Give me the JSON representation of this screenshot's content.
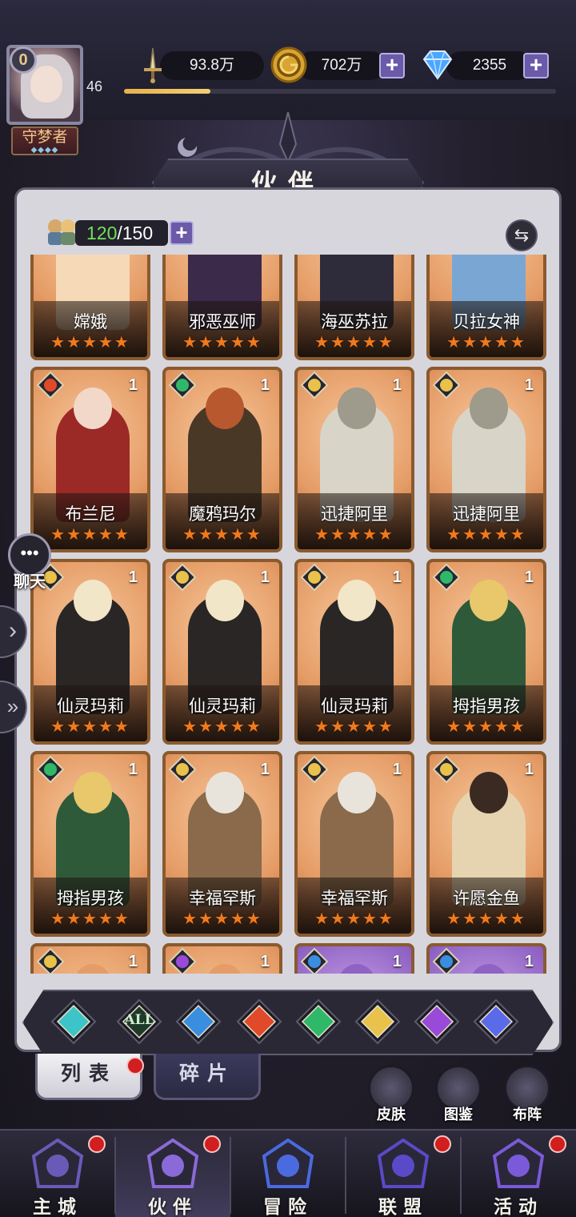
{
  "player": {
    "vip_level": "0",
    "title": "守梦者",
    "title_stars": "◆◆◆◆",
    "level": "46",
    "exp_progress": 0.2
  },
  "resources": {
    "power": "93.8万",
    "gold": "702万",
    "diamonds": "2355"
  },
  "panel": {
    "title": "伙伴",
    "capacity_current": "120",
    "capacity_max": "/150"
  },
  "elements": {
    "fire": "#e04a2a",
    "nature": "#2fb86a",
    "light": "#e8c24a",
    "water": "#3a8ee0",
    "shadow": "#9a4ad8",
    "cosmic": "#5a6ae8",
    "neutral": "#3cc4c8"
  },
  "cards": [
    {
      "name": "嫦娥",
      "stars": "★★★★★",
      "count": "",
      "element": "none",
      "palette": [
        "#f6d9b6",
        "#e9b98e"
      ]
    },
    {
      "name": "邪恶巫师",
      "stars": "★★★★★",
      "count": "",
      "element": "none",
      "palette": [
        "#3c2a4a",
        "#6b3f8c"
      ]
    },
    {
      "name": "海巫苏拉",
      "stars": "★★★★★",
      "count": "",
      "element": "none",
      "palette": [
        "#2e2c3a",
        "#6d6a82"
      ]
    },
    {
      "name": "贝拉女神",
      "stars": "★★★★★",
      "count": "",
      "element": "none",
      "palette": [
        "#7aa6d4",
        "#c9a46a"
      ]
    },
    {
      "name": "布兰尼",
      "stars": "★★★★★",
      "count": "1",
      "element": "fire",
      "palette": [
        "#9b2a26",
        "#f2d8c8"
      ]
    },
    {
      "name": "魔鸦玛尔",
      "stars": "★★★★★",
      "count": "1",
      "element": "nature",
      "palette": [
        "#4a3826",
        "#b8582e"
      ]
    },
    {
      "name": "迅捷阿里",
      "stars": "★★★★★",
      "count": "1",
      "element": "light",
      "palette": [
        "#d8d4c8",
        "#9e9a8c"
      ]
    },
    {
      "name": "迅捷阿里",
      "stars": "★★★★★",
      "count": "1",
      "element": "light",
      "palette": [
        "#d8d4c8",
        "#9e9a8c"
      ]
    },
    {
      "name": "仙灵玛莉",
      "stars": "★★★★★",
      "count": "1",
      "element": "light",
      "palette": [
        "#2a2626",
        "#f2e6c8"
      ]
    },
    {
      "name": "仙灵玛莉",
      "stars": "★★★★★",
      "count": "1",
      "element": "light",
      "palette": [
        "#2a2626",
        "#f2e6c8"
      ]
    },
    {
      "name": "仙灵玛莉",
      "stars": "★★★★★",
      "count": "1",
      "element": "light",
      "palette": [
        "#2a2626",
        "#f2e6c8"
      ]
    },
    {
      "name": "拇指男孩",
      "stars": "★★★★★",
      "count": "1",
      "element": "nature",
      "palette": [
        "#2e5a3a",
        "#e8c86a"
      ]
    },
    {
      "name": "拇指男孩",
      "stars": "★★★★★",
      "count": "1",
      "element": "nature",
      "palette": [
        "#2e5a3a",
        "#e8c86a"
      ]
    },
    {
      "name": "幸福罕斯",
      "stars": "★★★★★",
      "count": "1",
      "element": "light",
      "palette": [
        "#8a6a4a",
        "#e8e4dc"
      ]
    },
    {
      "name": "幸福罕斯",
      "stars": "★★★★★",
      "count": "1",
      "element": "light",
      "palette": [
        "#8a6a4a",
        "#e8e4dc"
      ]
    },
    {
      "name": "许愿金鱼",
      "stars": "★★★★★",
      "count": "1",
      "element": "light",
      "palette": [
        "#e6d4b0",
        "#3a2a22"
      ]
    },
    {
      "name": "",
      "stars": "",
      "count": "1",
      "element": "light",
      "palette": [
        "#e59c66",
        "#e59c66"
      ]
    },
    {
      "name": "",
      "stars": "",
      "count": "1",
      "element": "shadow",
      "palette": [
        "#e59c66",
        "#e59c66"
      ]
    },
    {
      "name": "",
      "stars": "",
      "count": "1",
      "element": "water",
      "palette": [
        "#8f62c4",
        "#8f62c4"
      ],
      "purple": true
    },
    {
      "name": "",
      "stars": "",
      "count": "1",
      "element": "water",
      "palette": [
        "#8f62c4",
        "#8f62c4"
      ],
      "purple": true
    }
  ],
  "filters": [
    {
      "name": "neutral",
      "label": ""
    },
    {
      "name": "all",
      "label": "ALL"
    },
    {
      "name": "water",
      "label": ""
    },
    {
      "name": "fire",
      "label": ""
    },
    {
      "name": "nature",
      "label": ""
    },
    {
      "name": "light",
      "label": ""
    },
    {
      "name": "shadow",
      "label": ""
    },
    {
      "name": "cosmic",
      "label": ""
    }
  ],
  "tabs": {
    "list": "列表",
    "fragments": "碎片"
  },
  "side_buttons": {
    "skin": "皮肤",
    "codex": "图鉴",
    "formation": "布阵"
  },
  "chat": {
    "label": "聊天"
  },
  "nav": [
    {
      "label": "主城",
      "badge": true
    },
    {
      "label": "伙伴",
      "badge": true,
      "active": true
    },
    {
      "label": "冒险",
      "badge": false
    },
    {
      "label": "联盟",
      "badge": true
    },
    {
      "label": "活动",
      "badge": true
    }
  ]
}
